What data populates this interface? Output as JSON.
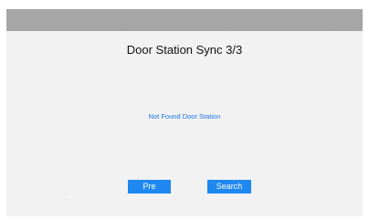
{
  "page": {
    "title": "Door Station Sync 3/3",
    "status_message": "Not Found Door Station"
  },
  "actions": {
    "pre_label": "Pre",
    "search_label": "Search"
  },
  "colors": {
    "top_bar": "#a4a4a4",
    "background": "#f2f2f2",
    "accent": "#1e88f0",
    "message_text": "#1976e6"
  }
}
